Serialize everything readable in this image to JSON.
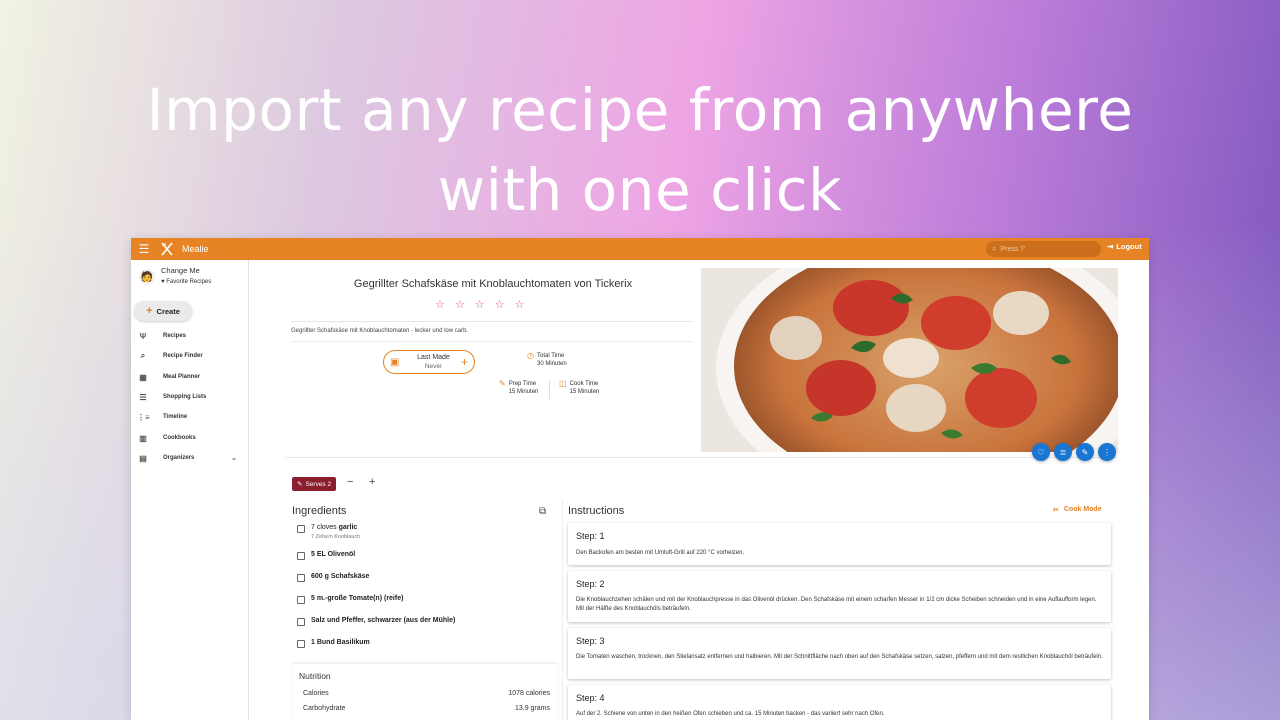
{
  "headline": {
    "line1": "Import any recipe from anywhere",
    "line2": "with one click"
  },
  "app": {
    "name": "Mealie",
    "search_placeholder": "Press '/'",
    "logout_label": "Logout",
    "accent": "#e58325"
  },
  "sidebar": {
    "user_name": "Change Me",
    "favorites_label": "Favorite Recipes",
    "create_label": "Create",
    "items": [
      {
        "label": "Recipes",
        "icon": "fork-knife-icon"
      },
      {
        "label": "Recipe Finder",
        "icon": "search-icon"
      },
      {
        "label": "Meal Planner",
        "icon": "calendar-icon"
      },
      {
        "label": "Shopping Lists",
        "icon": "checklist-icon"
      },
      {
        "label": "Timeline",
        "icon": "timeline-icon"
      },
      {
        "label": "Cookbooks",
        "icon": "book-icon"
      },
      {
        "label": "Organizers",
        "icon": "folder-icon"
      }
    ]
  },
  "recipe": {
    "title": "Gegrillter Schafskäse mit Knoblauchtomaten von Tickerix",
    "description": "Gegrillter Schafskäse mit Knoblauchtomaten - lecker und low carb.",
    "rating": 0,
    "last_made_label": "Last Made",
    "last_made_value": "Never",
    "total_time_label": "Total Time",
    "total_time_value": "30 Minuten",
    "prep_time_label": "Prep Time",
    "prep_time_value": "15 Minuten",
    "cook_time_label": "Cook Time",
    "cook_time_value": "15 Minuten",
    "serves_label": "Serves 2"
  },
  "ingredients": {
    "title": "Ingredients",
    "items": [
      {
        "text": "7 cloves ",
        "bold": "garlic",
        "note": "7 Zehe/n Knoblauch"
      },
      {
        "text": "",
        "bold": "5 EL Olivenöl",
        "note": ""
      },
      {
        "text": "",
        "bold": "600 g Schafskäse",
        "note": ""
      },
      {
        "text": "",
        "bold": "5 m.-große Tomate(n) (reife)",
        "note": ""
      },
      {
        "text": "",
        "bold": "Salz und Pfeffer, schwarzer (aus der Mühle)",
        "note": ""
      },
      {
        "text": "",
        "bold": "1 Bund Basilikum",
        "note": ""
      }
    ]
  },
  "nutrition": {
    "title": "Nutrition",
    "rows": [
      {
        "label": "Calories",
        "value": "1078 calories"
      },
      {
        "label": "Carbohydrate",
        "value": "13.9 grams"
      }
    ]
  },
  "instructions": {
    "title": "Instructions",
    "cook_mode_label": "Cook Mode",
    "steps": [
      {
        "title": "Step: 1",
        "text": "Den Backofen am besten mit Umluft-Grill auf 220 °C vorheizen."
      },
      {
        "title": "Step: 2",
        "text": "Die Knoblauchzehen schälen und mit der Knoblauchpresse in das Olivenöl drücken. Den Schafskäse mit einem scharfen Messer in 1/2 cm dicke Scheiben schneiden und in eine Auflaufform legen. Mit der Hälfte des Knoblauchöls beträufeln."
      },
      {
        "title": "Step: 3",
        "text": "Die Tomaten waschen, trocknen, den Stielansatz entfernen und halbieren. Mit der Schnittfläche nach oben auf den Schafskäse setzen, salzen, pfeffern und mit dem restlichen Knoblauchöl beträufeln."
      },
      {
        "title": "Step: 4",
        "text": "Auf der 2. Schiene von unten in den heißen Ofen schieben und ca. 15 Minuten backen - das variiert sehr nach Ofen."
      }
    ]
  }
}
